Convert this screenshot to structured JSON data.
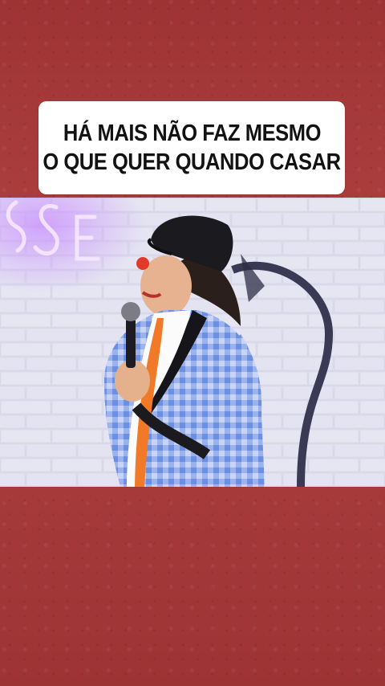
{
  "caption": {
    "line1": "HÁ MAIS NÃO FAZ MESMO",
    "line2": "O QUE QUER QUANDO CASAR"
  },
  "colors": {
    "background": "#a63a3a",
    "caption_background": "#ffffff",
    "caption_text": "#121212",
    "wall": "#dcdcec",
    "shirt_check": "#5b7fd6",
    "tie": "#f07a28"
  },
  "video": {
    "description_icon": "comedian-performance-video"
  }
}
